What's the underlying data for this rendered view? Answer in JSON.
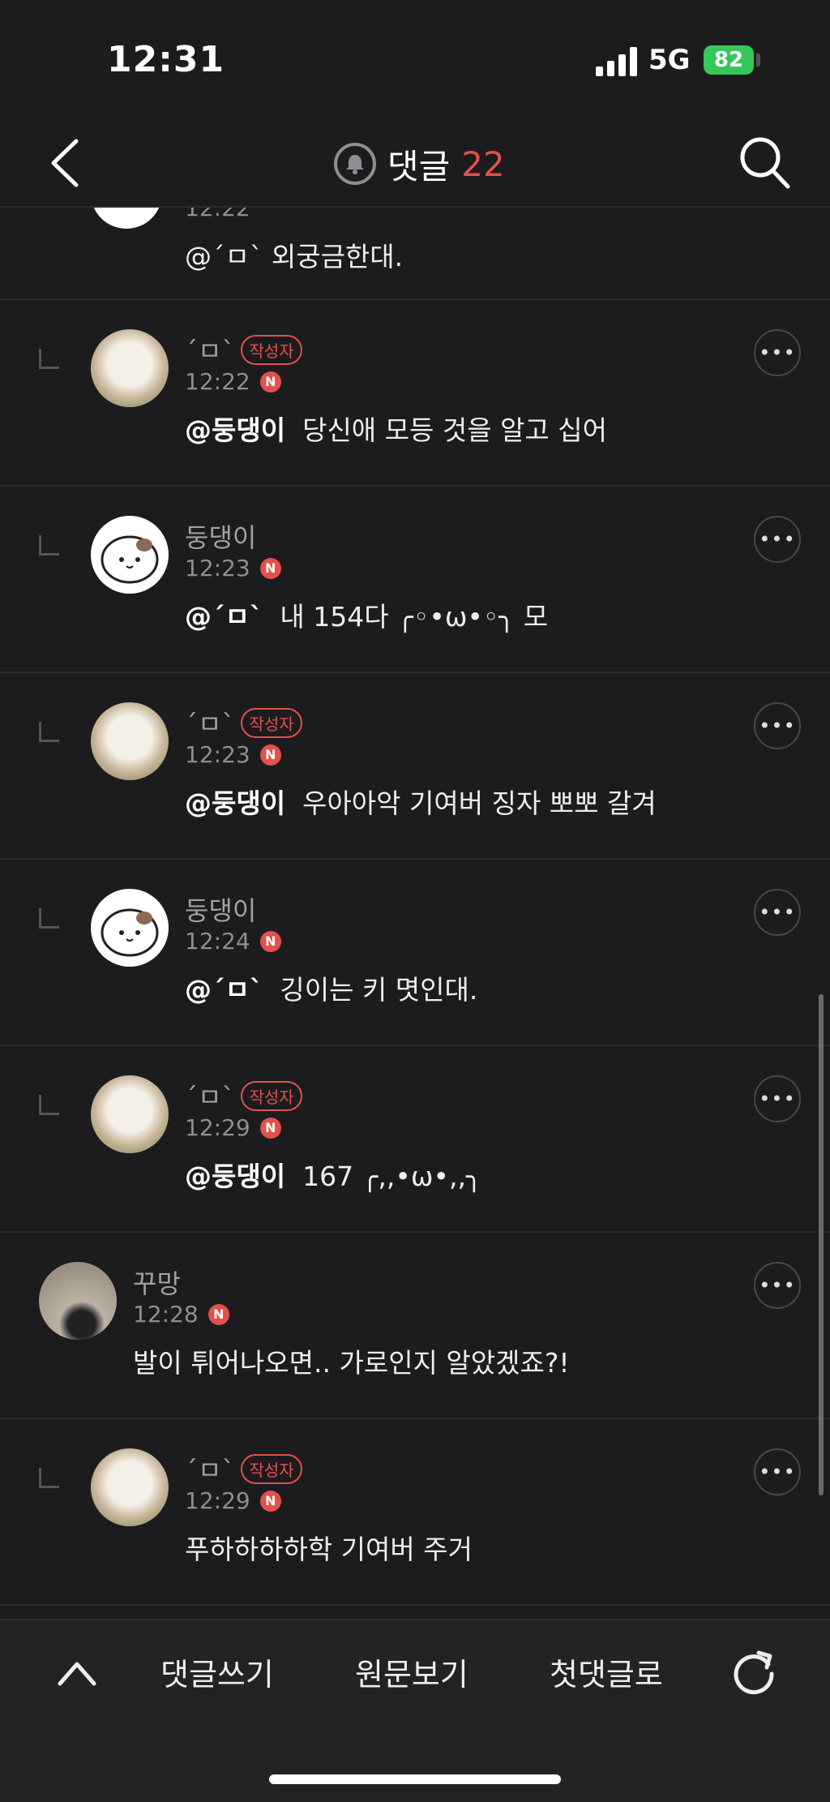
{
  "status": {
    "time": "12:31",
    "network": "5G",
    "battery": "82"
  },
  "header": {
    "title": "댓글",
    "count": "22"
  },
  "partial_comment": {
    "time": "12:22",
    "text": "@´ㅁ`  외궁금한대."
  },
  "comments": [
    {
      "name": "´ㅁ`",
      "author_badge": "작성자",
      "time": "12:22",
      "mention": "@둥댕이",
      "text": "당신애 모등 것을 알고 십어"
    },
    {
      "name": "둥댕이",
      "time": "12:23",
      "mention": "@´ㅁ`",
      "text": "내 154다 ╭◦•ω•◦╮ 모"
    },
    {
      "name": "´ㅁ`",
      "author_badge": "작성자",
      "time": "12:23",
      "mention": "@둥댕이",
      "text": "우아아악 기여버 징자 뽀뽀 갈겨"
    },
    {
      "name": "둥댕이",
      "time": "12:24",
      "mention": "@´ㅁ`",
      "text": "깅이는 키 몃인대."
    },
    {
      "name": "´ㅁ`",
      "author_badge": "작성자",
      "time": "12:29",
      "mention": "@둥댕이",
      "text": "167 ╭,,•ω•,,╮"
    },
    {
      "name": "꾸망",
      "time": "12:28",
      "text": "발이 튀어나오면.. 가로인지 알았겠죠?!"
    },
    {
      "name": "´ㅁ`",
      "author_badge": "작성자",
      "time": "12:29",
      "text": "푸하하하하학 기여버 주거"
    }
  ],
  "new_badge": "N",
  "more_label": "•••",
  "bottom": {
    "write": "댓글쓰기",
    "original": "원문보기",
    "first": "첫댓글로"
  }
}
